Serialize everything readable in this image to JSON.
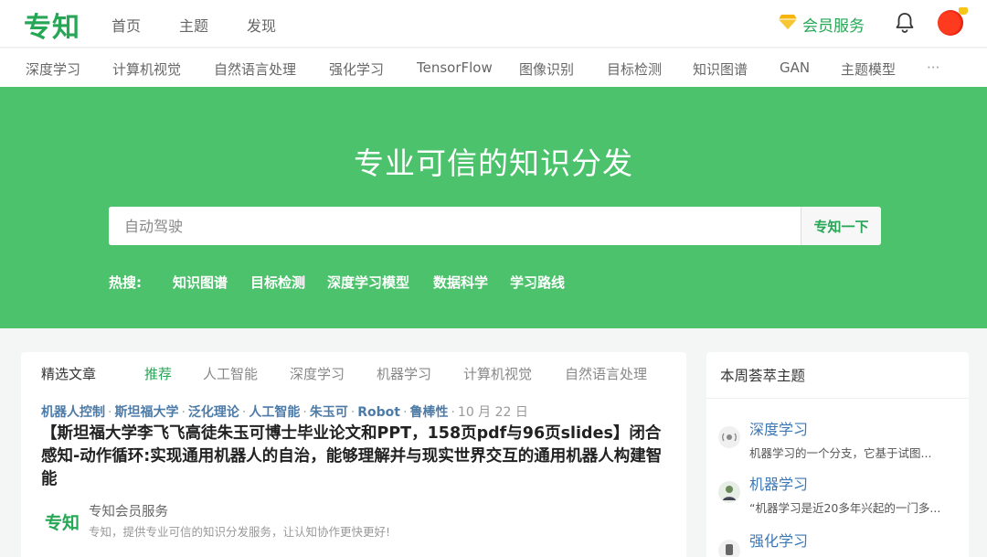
{
  "header": {
    "logo": "专知",
    "nav": [
      "首页",
      "主题",
      "发现"
    ],
    "vip_label": "会员服务",
    "icons": {
      "vip": "diamond-icon",
      "bell": "bell-icon",
      "avatar": "avatar"
    },
    "accent_color": "#27a656"
  },
  "topics": [
    "深度学习",
    "计算机视觉",
    "自然语言处理",
    "强化学习",
    "TensorFlow",
    "图像识别",
    "目标检测",
    "知识图谱",
    "GAN",
    "主题模型",
    "···"
  ],
  "hero": {
    "title": "专业可信的知识分发",
    "search_placeholder": "自动驾驶",
    "search_button": "专知一下",
    "hot_label": "热搜:",
    "hot_items": [
      "知识图谱",
      "目标检测",
      "深度学习模型",
      "数据科学",
      "学习路线"
    ],
    "background_color": "#4cc26c"
  },
  "main": {
    "section_label": "精选文章",
    "tabs": [
      "推荐",
      "人工智能",
      "深度学习",
      "机器学习",
      "计算机视觉",
      "自然语言处理"
    ],
    "article": {
      "tags": [
        "机器人控制",
        "斯坦福大学",
        "泛化理论",
        "人工智能",
        "朱玉可",
        "Robot",
        "鲁棒性"
      ],
      "date": "10 月 22 日",
      "title": "【斯坦福大学李飞飞高徒朱玉可博士毕业论文和PPT，158页pdf与96页slides】闭合感知-动作循环:实现通用机器人的自治，能够理解并与现实世界交互的通用机器人构建智能"
    },
    "promo": {
      "logo": "专知",
      "title": "专知会员服务",
      "desc": "专知，提供专业可信的知识分发服务，让认知协作更快更好!"
    }
  },
  "side": {
    "title": "本周荟萃主题",
    "items": [
      {
        "name": "深度学习",
        "desc": "机器学习的一个分支，它基于试图...",
        "icon": "topic-dl-icon"
      },
      {
        "name": "机器学习",
        "desc": "“机器学习是近20多年兴起的一门多...",
        "icon": "topic-ml-icon"
      },
      {
        "name": "强化学习",
        "desc": "",
        "icon": "topic-rl-icon"
      }
    ]
  }
}
